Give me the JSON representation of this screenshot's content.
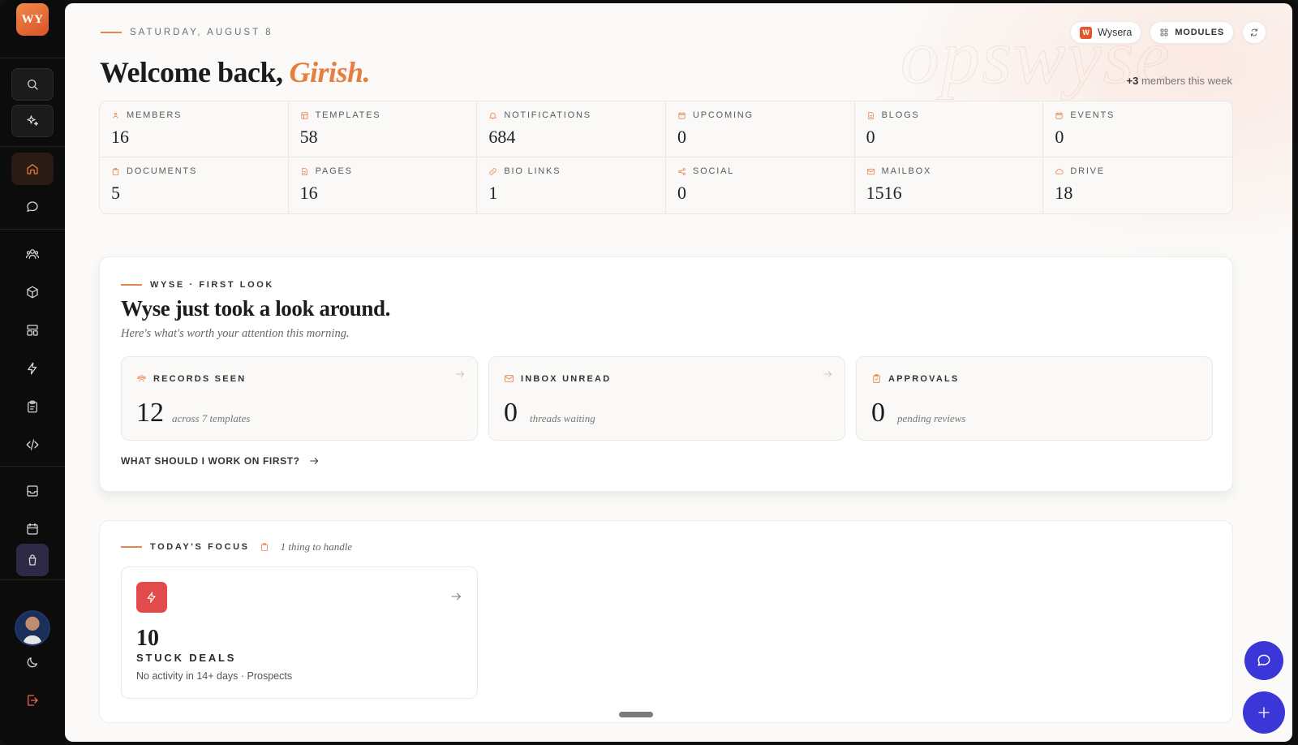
{
  "brand": {
    "logo_text": "WY"
  },
  "header": {
    "date": "SATURDAY, AUGUST 8",
    "welcome": "Welcome back,",
    "name": "Girish.",
    "workspace": "Wysera",
    "workspace_badge": "W",
    "modules_label": "MODULES",
    "members_count": "+3",
    "members_text": "members this week",
    "watermark": "opswyse"
  },
  "stats": [
    {
      "label": "MEMBERS",
      "value": "16",
      "icon": "members-icon"
    },
    {
      "label": "TEMPLATES",
      "value": "58",
      "icon": "templates-icon"
    },
    {
      "label": "NOTIFICATIONS",
      "value": "684",
      "icon": "bell-icon"
    },
    {
      "label": "UPCOMING",
      "value": "0",
      "icon": "calendar-icon"
    },
    {
      "label": "BLOGS",
      "value": "0",
      "icon": "document-icon"
    },
    {
      "label": "EVENTS",
      "value": "0",
      "icon": "calendar-icon"
    },
    {
      "label": "DOCUMENTS",
      "value": "5",
      "icon": "clipboard-icon"
    },
    {
      "label": "PAGES",
      "value": "16",
      "icon": "document-icon"
    },
    {
      "label": "BIO LINKS",
      "value": "1",
      "icon": "link-icon"
    },
    {
      "label": "SOCIAL",
      "value": "0",
      "icon": "share-icon"
    },
    {
      "label": "MAILBOX",
      "value": "1516",
      "icon": "mail-icon"
    },
    {
      "label": "DRIVE",
      "value": "18",
      "icon": "cloud-icon"
    }
  ],
  "first_look": {
    "eyebrow": "WYSE · FIRST LOOK",
    "title": "Wyse just took a look around.",
    "subtitle": "Here's what's worth your attention this morning.",
    "tiles": [
      {
        "label": "RECORDS SEEN",
        "value": "12",
        "note": "across 7 templates"
      },
      {
        "label": "INBOX UNREAD",
        "value": "0",
        "note": "threads waiting"
      },
      {
        "label": "APPROVALS",
        "value": "0",
        "note": "pending reviews"
      }
    ],
    "cta": "WHAT SHOULD I WORK ON FIRST?"
  },
  "focus": {
    "eyebrow": "TODAY'S FOCUS",
    "sub": "1 thing to handle",
    "tile": {
      "value": "10",
      "label": "STUCK DEALS",
      "sub": "No activity in 14+ days · Prospects"
    }
  },
  "colors": {
    "accent": "#e67f3e",
    "danger": "#e24b4b",
    "fab": "#3a36d8",
    "sidebar": "#0c0c0c"
  }
}
